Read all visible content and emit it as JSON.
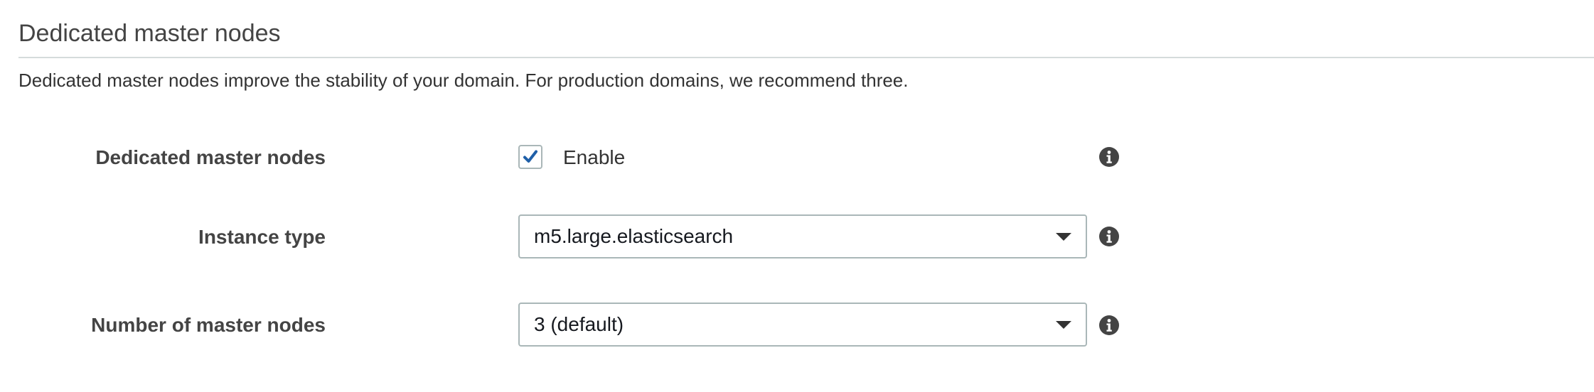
{
  "section": {
    "title": "Dedicated master nodes",
    "description": "Dedicated master nodes improve the stability of your domain. For production domains, we recommend three."
  },
  "fields": {
    "dedicated_master": {
      "label": "Dedicated master nodes",
      "checkbox_label": "Enable",
      "checked": true
    },
    "instance_type": {
      "label": "Instance type",
      "value": "m5.large.elasticsearch"
    },
    "master_count": {
      "label": "Number of master nodes",
      "value": "3 (default)"
    }
  },
  "icons": {
    "info": "info-icon",
    "checkmark": "checkmark-icon",
    "caret": "caret-down-icon"
  },
  "colors": {
    "checkmark": "#1f5fa8",
    "border": "#aab7b8",
    "info_icon": "#444444",
    "divider": "#d5dbdb"
  }
}
